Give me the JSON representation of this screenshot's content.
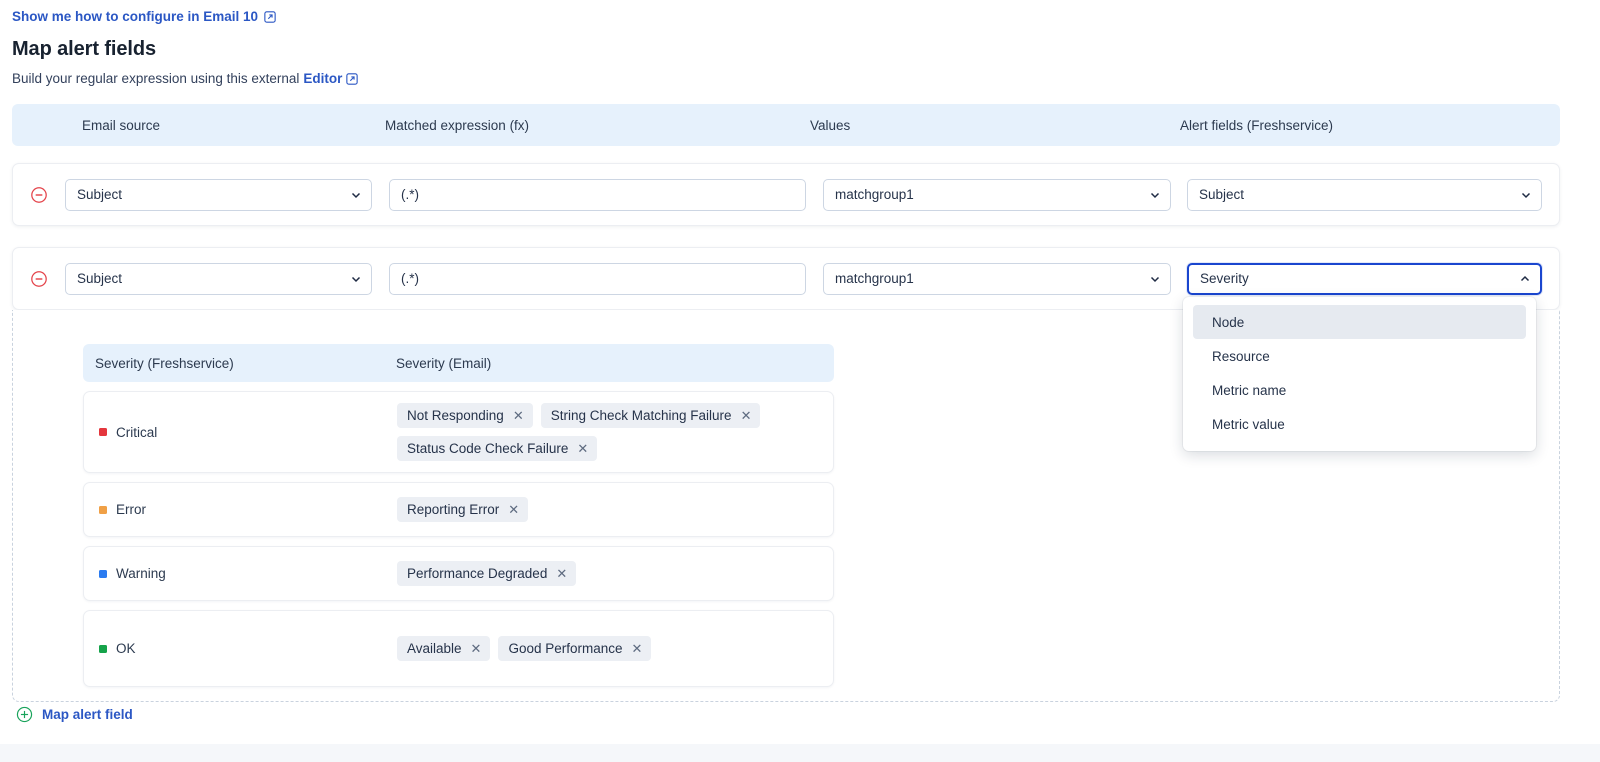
{
  "header": {
    "configure_link": "Show me how to configure in Email 10",
    "configure_link_icon": "external-link-icon",
    "title": "Map alert fields",
    "subtitle_prefix": "Build your regular expression using this external",
    "subtitle_link": "Editor",
    "subtitle_link_icon": "external-link-icon"
  },
  "grid": {
    "columns": [
      {
        "label": "Email source"
      },
      {
        "label": "Matched expression (fx)"
      },
      {
        "label": "Values"
      },
      {
        "label": "Alert fields (Freshservice)"
      }
    ],
    "rows": [
      {
        "remove_icon": "minus-circle-icon",
        "email_source": "Subject",
        "matched_expression": "(.*)",
        "matched_expression_placeholder": "(.*)",
        "values": "matchgroup1",
        "alert_field": "Subject",
        "alert_field_focused": false,
        "chevron": "chevron-down-icon"
      },
      {
        "remove_icon": "minus-circle-icon",
        "email_source": "Subject",
        "matched_expression": "(.*)",
        "matched_expression_placeholder": "(.*)",
        "values": "matchgroup1",
        "alert_field": "Severity",
        "alert_field_focused": true,
        "chevron": "chevron-up-icon"
      }
    ]
  },
  "alert_field_dropdown": {
    "open": true,
    "selected": "Severity",
    "options": [
      {
        "label": "Node",
        "highlighted": true
      },
      {
        "label": "Resource",
        "highlighted": false
      },
      {
        "label": "Metric name",
        "highlighted": false
      },
      {
        "label": "Metric value",
        "highlighted": false
      }
    ]
  },
  "severity_table": {
    "columns": [
      {
        "label": "Severity (Freshservice)"
      },
      {
        "label": "Severity (Email)"
      }
    ],
    "rows": [
      {
        "severity": "Critical",
        "color": "#e4363d",
        "chips": [
          {
            "label": "Not Responding",
            "remove_icon": "close-icon"
          },
          {
            "label": "String Check Matching Failure",
            "remove_icon": "close-icon"
          },
          {
            "label": "Status Code Check Failure",
            "remove_icon": "close-icon"
          }
        ]
      },
      {
        "severity": "Error",
        "color": "#f0a046",
        "chips": [
          {
            "label": "Reporting Error",
            "remove_icon": "close-icon"
          }
        ]
      },
      {
        "severity": "Warning",
        "color": "#2b7bf0",
        "chips": [
          {
            "label": "Performance Degraded",
            "remove_icon": "close-icon"
          }
        ]
      },
      {
        "severity": "OK",
        "color": "#15a34a",
        "chips": [
          {
            "label": "Available",
            "remove_icon": "close-icon"
          },
          {
            "label": "Good Performance",
            "remove_icon": "close-icon"
          }
        ]
      }
    ]
  },
  "footer": {
    "add_icon": "plus-circle-icon",
    "add_label": "Map alert field"
  },
  "colors": {
    "accent_blue": "#2b57c4",
    "header_bg": "#e6f1fc",
    "focus_border": "#1a46cf",
    "remove_red": "#e4434a",
    "add_green": "#19a35b",
    "chip_bg": "#eceff4"
  }
}
